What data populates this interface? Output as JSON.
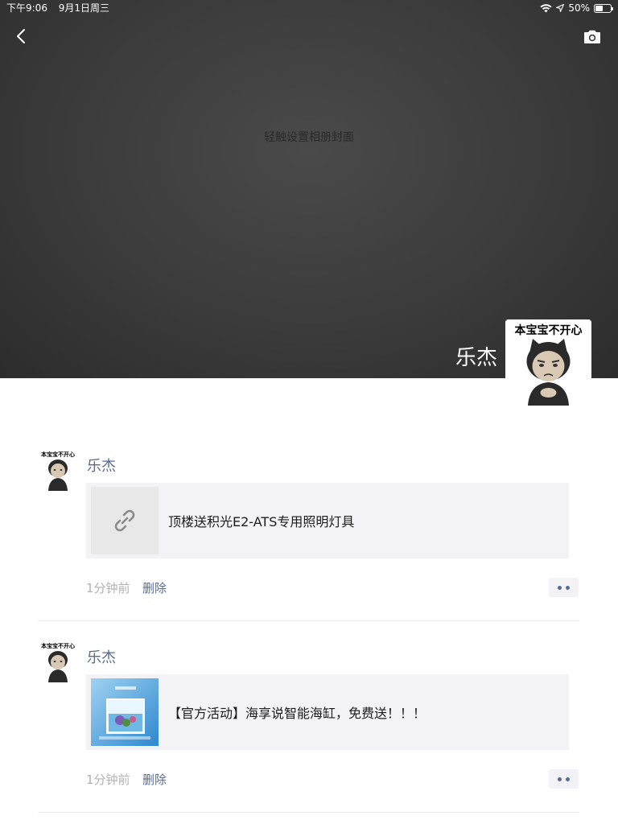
{
  "status_bar": {
    "time": "下午9:06",
    "date": "9月1日周三",
    "battery": "50%",
    "battery_level": 0.5
  },
  "cover": {
    "hint": "轻触设置相册封面"
  },
  "profile": {
    "name": "乐杰",
    "avatar_caption": "本宝宝不开心"
  },
  "posts": [
    {
      "author": "乐杰",
      "avatar_caption": "本宝宝不开心",
      "link_title": "顶楼送积光E2-ATS专用照明灯具",
      "thumb": "link-icon",
      "time": "1分钟前",
      "delete_label": "删除"
    },
    {
      "author": "乐杰",
      "avatar_caption": "本宝宝不开心",
      "link_title": "【官方活动】海享说智能海缸，免费送！！！",
      "thumb": "aquarium-image",
      "time": "1分钟前",
      "delete_label": "删除"
    }
  ],
  "icons": {
    "back": "chevron-left-icon",
    "camera": "camera-icon",
    "more": "more-dots-icon"
  },
  "colors": {
    "link_blue": "#576b95",
    "card_bg": "#f3f3f5",
    "cover_bg": "#3b3b3b"
  }
}
